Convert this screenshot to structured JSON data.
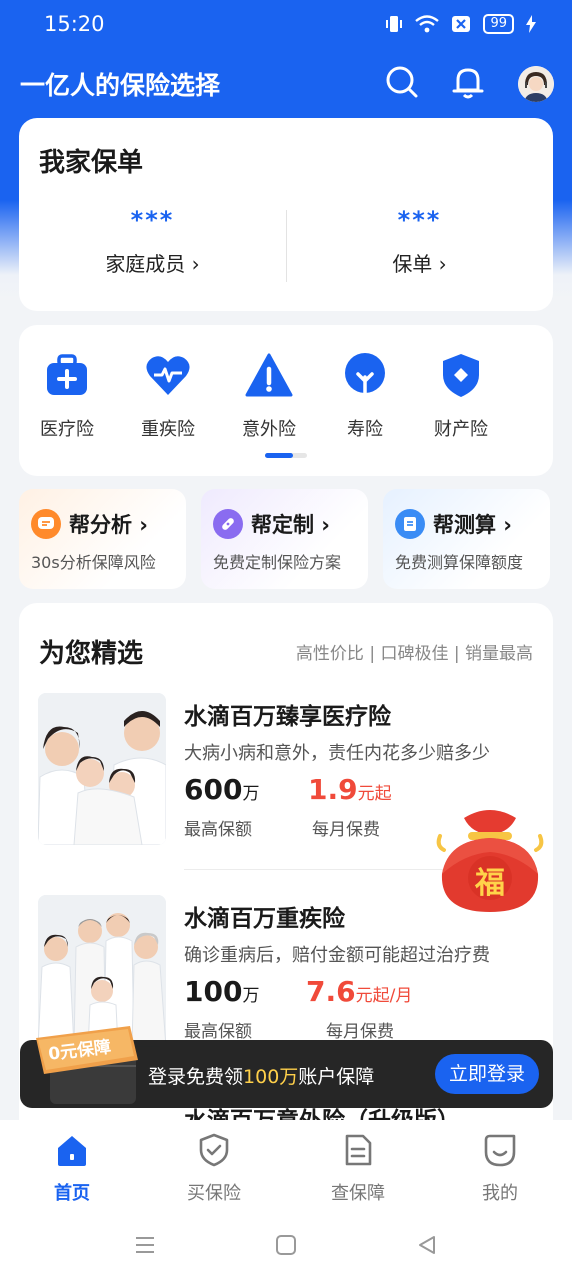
{
  "status": {
    "time": "15:20",
    "battery": "99"
  },
  "header": {
    "title": "一亿人的保险选择"
  },
  "policy_card": {
    "title": "我家保单",
    "items": [
      {
        "value": "***",
        "label": "家庭成员 ›"
      },
      {
        "value": "***",
        "label": "保单 ›"
      }
    ]
  },
  "categories": [
    {
      "label": "医疗险",
      "icon": "medical-kit-icon"
    },
    {
      "label": "重疾险",
      "icon": "heart-pulse-icon"
    },
    {
      "label": "意外险",
      "icon": "warning-triangle-icon"
    },
    {
      "label": "寿险",
      "icon": "tree-icon"
    },
    {
      "label": "财产险",
      "icon": "shield-icon"
    }
  ],
  "help_cards": [
    {
      "title": "帮分析 ›",
      "subtitle": "30s分析保障风险",
      "accent": "#ff8a2b"
    },
    {
      "title": "帮定制 ›",
      "subtitle": "免费定制保险方案",
      "accent": "#8a6cf0"
    },
    {
      "title": "帮测算 ›",
      "subtitle": "免费测算保障额度",
      "accent": "#3a8cf5"
    }
  ],
  "picks": {
    "title": "为您精选",
    "tags": "高性价比 | 口碑极佳 | 销量最高",
    "products": [
      {
        "name": "水滴百万臻享医疗险",
        "desc": "大病小病和意外，责任内花多少赔多少",
        "coverage": "600",
        "coverage_unit": "万",
        "coverage_label": "最高保额",
        "price": "1.9",
        "price_unit": "元起",
        "price_label": "每月保费"
      },
      {
        "name": "水滴百万重疾险",
        "desc": "确诊重病后，赔付金额可能超过治疗费",
        "coverage": "100",
        "coverage_unit": "万",
        "coverage_label": "最高保额",
        "price": "7.6",
        "price_unit": "元起/月",
        "price_label": "每月保费"
      },
      {
        "name": "水滴百万意外险（升级版）"
      }
    ]
  },
  "lucky_bag": {
    "text": "福"
  },
  "login_banner": {
    "badge": "0元保障",
    "text_before": "登录免费领",
    "text_highlight": "100万",
    "text_after": "账户保障",
    "button": "立即登录"
  },
  "tabs": [
    {
      "label": "首页",
      "active": true
    },
    {
      "label": "买保险"
    },
    {
      "label": "查保障"
    },
    {
      "label": "我的"
    }
  ],
  "colors": {
    "brand": "#1a63f0",
    "price_red": "#f04a3a"
  }
}
